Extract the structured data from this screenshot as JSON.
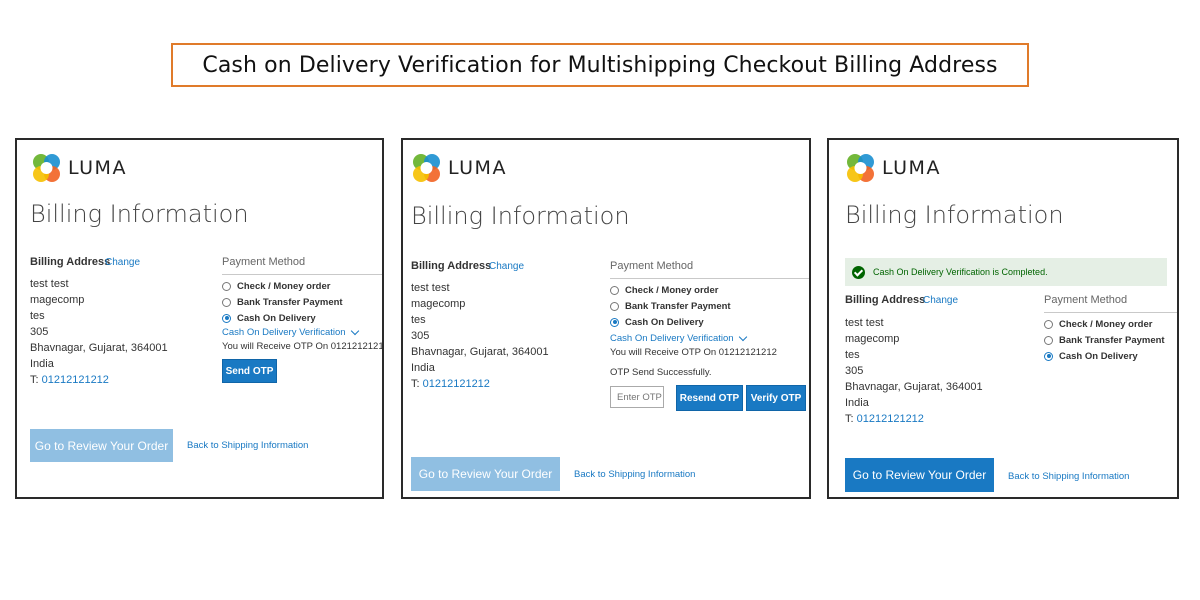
{
  "title": "Cash on Delivery Verification for Multishipping Checkout Billing Address",
  "logo_text": "LUMA",
  "heading": "Billing Information",
  "billing_address_label": "Billing Address",
  "change_label": "Change",
  "address": {
    "line1": "test test",
    "line2": "magecomp",
    "line3": "tes",
    "line4": "305",
    "line5": "Bhavnagar, Gujarat, 364001",
    "line6": "India",
    "phone_prefix": "T: ",
    "phone": "01212121212"
  },
  "payment_method_label": "Payment Method",
  "payment_options": {
    "check": "Check / Money order",
    "bank": "Bank Transfer Payment",
    "cod": "Cash On Delivery"
  },
  "cod_verification_link": "Cash On Delivery Verification",
  "otp_info": "You will Receive OTP On 01212121212",
  "send_otp": "Send OTP",
  "otp_sent_message": "OTP Send Successfully.",
  "otp_placeholder": "Enter OTP",
  "resend_otp": "Resend OTP",
  "verify_otp": "Verify OTP",
  "review_order": "Go to Review Your Order",
  "back_to_shipping": "Back to Shipping Information",
  "success_message": "Cash On Delivery Verification is Completed.",
  "colors": {
    "accent": "#1979c3",
    "title_border": "#e07b2a",
    "success_bg": "#e5efe5",
    "success_text": "#006400",
    "disabled_button": "#90bfe2"
  }
}
